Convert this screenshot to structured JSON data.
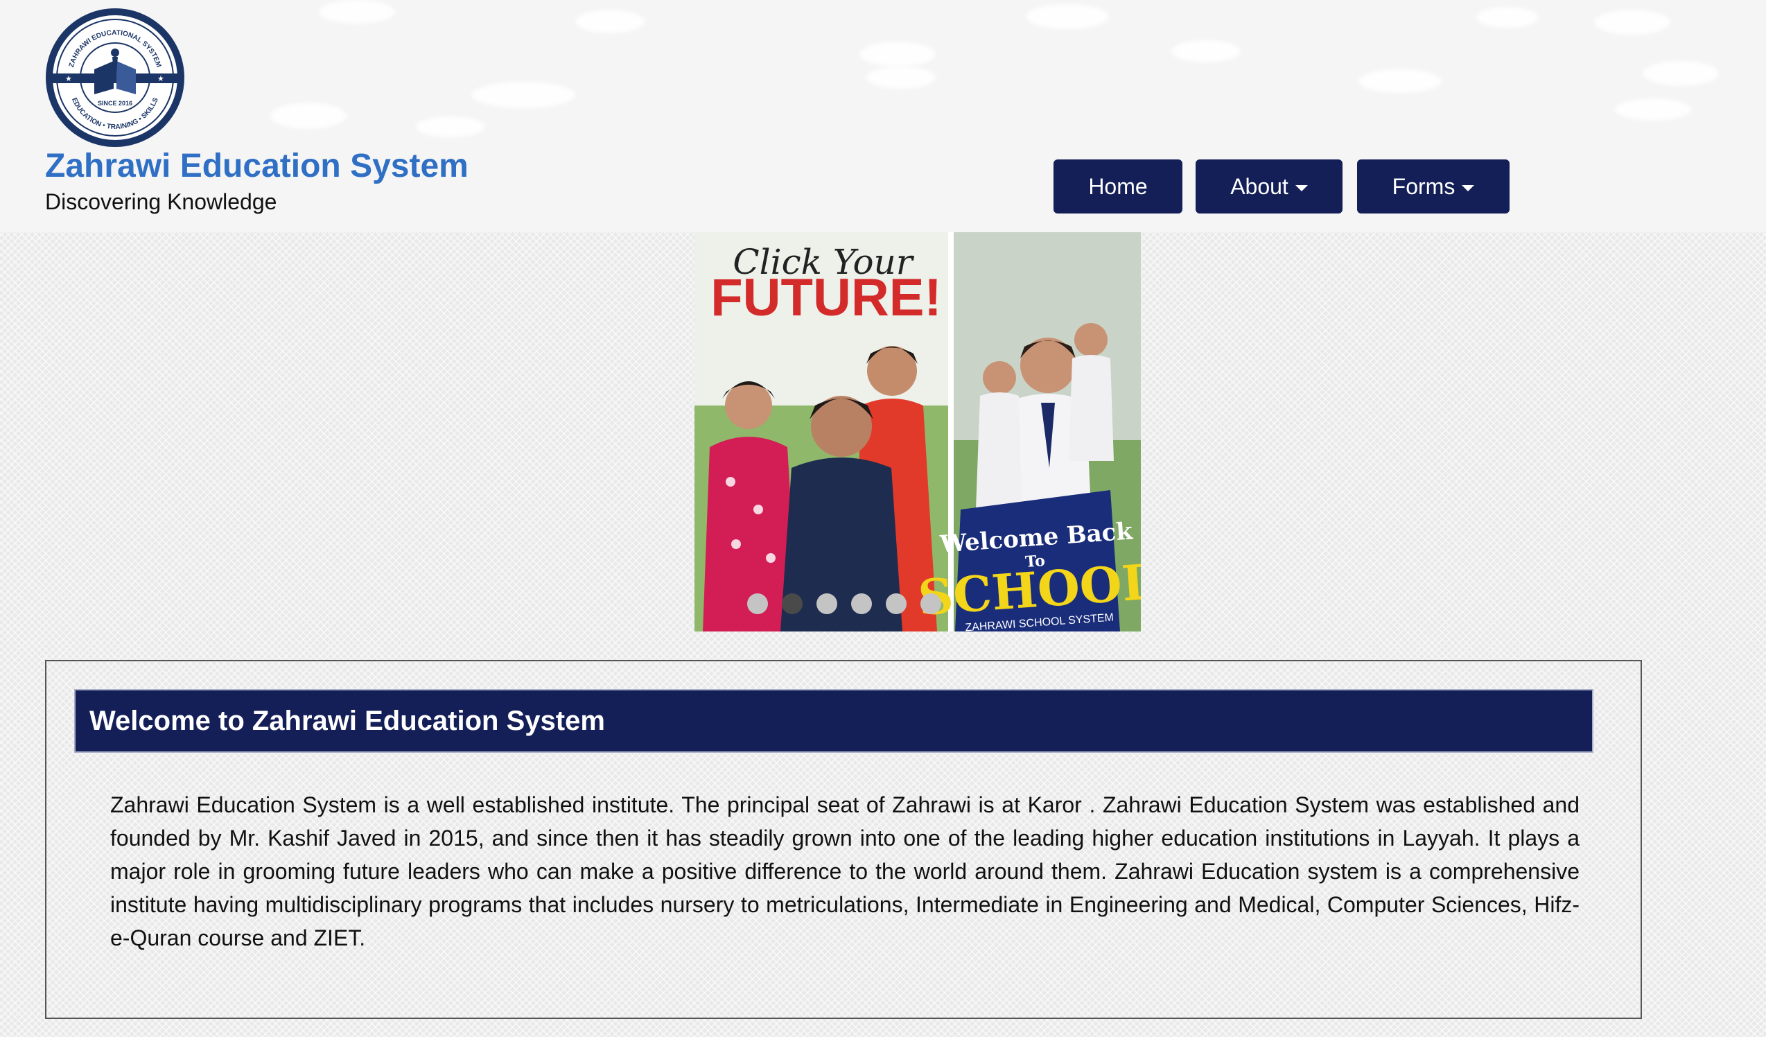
{
  "header": {
    "site_title": "Zahrawi Education System",
    "tagline": "Discovering Knowledge",
    "logo": {
      "icon": "school-emblem",
      "ring_text": "ZAHRAWI EDUCATIONAL SYSTEM",
      "lower_text": "EDUCATION • TRAINING • SKILLS",
      "since": "SINCE 2016"
    }
  },
  "nav": {
    "home": "Home",
    "about": "About",
    "forms": "Forms"
  },
  "slider": {
    "slide": {
      "script_text": "Click Your",
      "headline": "FUTURE!",
      "sign_line1": "Welcome Back",
      "sign_line2": "To",
      "sign_line3": "SCHOOL",
      "sign_footer": "ZAHRAWI SCHOOL SYSTEM"
    },
    "dot_count": 6,
    "active_dot": 2
  },
  "welcome": {
    "heading": "Welcome to Zahrawi Education System",
    "body": "Zahrawi Education System is a well established institute. The principal seat of Zahrawi is at Karor . Zahrawi Education System was established and founded by Mr. Kashif Javed in 2015, and since then it has steadily grown into one of the leading higher education institutions in Layyah. It plays a major role in grooming future leaders who can make a positive difference to the world around them. Zahrawi Education system is a comprehensive institute having multidisciplinary programs that includes nursery to metriculations, Intermediate in Engineering and Medical, Computer Sciences, Hifz-e-Quran course and ZIET."
  },
  "colors": {
    "brand_navy": "#141f57",
    "title_blue": "#2f6fc4",
    "accent_red": "#d32a2a",
    "sign_yellow": "#f3d51a"
  }
}
